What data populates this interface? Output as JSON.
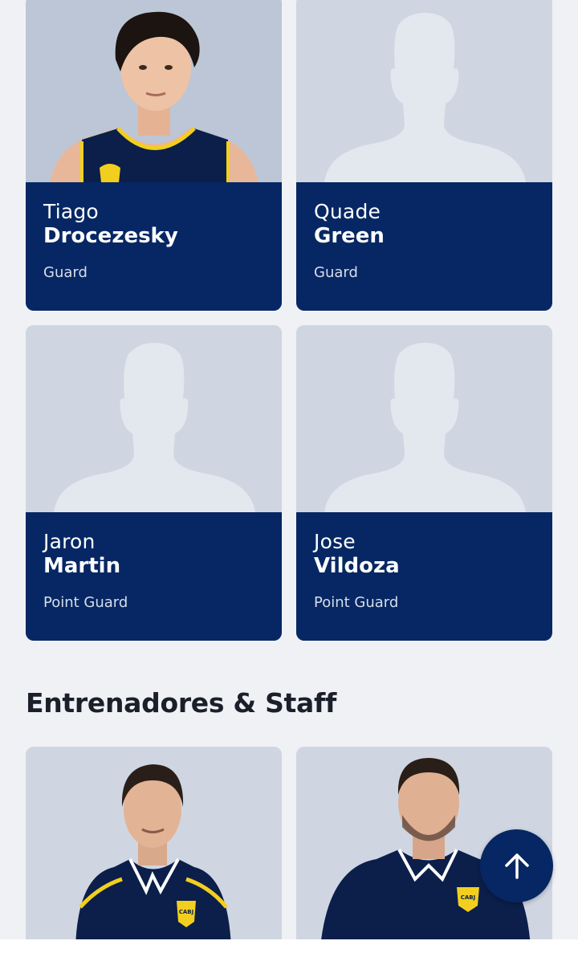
{
  "players": [
    {
      "first": "Tiago",
      "last": "Drocezesky",
      "position": "Guard",
      "photo": "real"
    },
    {
      "first": "Quade",
      "last": "Green",
      "position": "Guard",
      "photo": "placeholder"
    },
    {
      "first": "Jaron",
      "last": "Martin",
      "position": "Point Guard",
      "photo": "placeholder"
    },
    {
      "first": "Jose",
      "last": "Vildoza",
      "position": "Point Guard",
      "photo": "placeholder"
    }
  ],
  "staff_section": {
    "title": "Entrenadores & Staff"
  },
  "staff": [
    {
      "photo": "real",
      "logo_text": "CABJ"
    },
    {
      "photo": "real",
      "logo_text": "CABJ"
    }
  ],
  "player_logo_text": "CABJ",
  "icons": {
    "scroll_top": "arrow-up-icon"
  },
  "colors": {
    "navy": "#062763",
    "background": "#eff1f5",
    "placeholder": "#cfd6e2"
  }
}
